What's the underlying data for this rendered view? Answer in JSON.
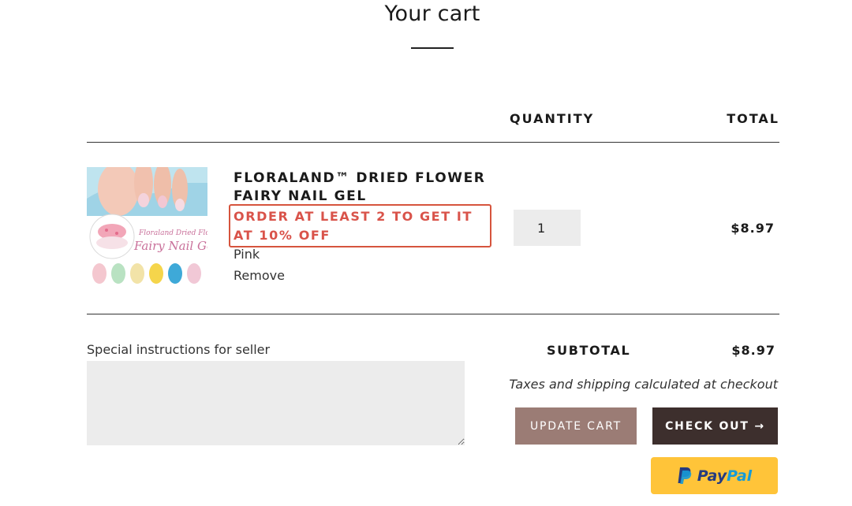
{
  "page": {
    "title": "Your cart"
  },
  "table": {
    "quantity_header": "QUANTITY",
    "total_header": "TOTAL"
  },
  "item": {
    "name": "FLORALAND™ DRIED FLOWER FAIRY NAIL GEL",
    "promo": "ORDER AT LEAST 2 TO GET IT AT 10% OFF",
    "promo_color": "#d9534a",
    "variant": "Pink",
    "remove_label": "Remove",
    "quantity": "1",
    "line_total": "$8.97",
    "image": {
      "icon": "product-photo-nail-gel",
      "brand_text": "Floraland Dried Flower",
      "product_text": "Fairy Nail Gel"
    }
  },
  "instructions": {
    "label": "Special instructions for seller",
    "value": ""
  },
  "summary": {
    "subtotal_label": "SUBTOTAL",
    "subtotal_value": "$8.97",
    "tax_note": "Taxes and shipping calculated at checkout"
  },
  "actions": {
    "update_cart_label": "UPDATE CART",
    "checkout_label": "CHECK OUT →",
    "paypal_pay": "Pay",
    "paypal_pal": "Pal",
    "paypal_icon": "paypal-logo-icon"
  },
  "colors": {
    "update_button": "#9b7c75",
    "checkout_button": "#3d2f2d",
    "paypal_button": "#ffc439",
    "promo_border": "#d6543d"
  }
}
